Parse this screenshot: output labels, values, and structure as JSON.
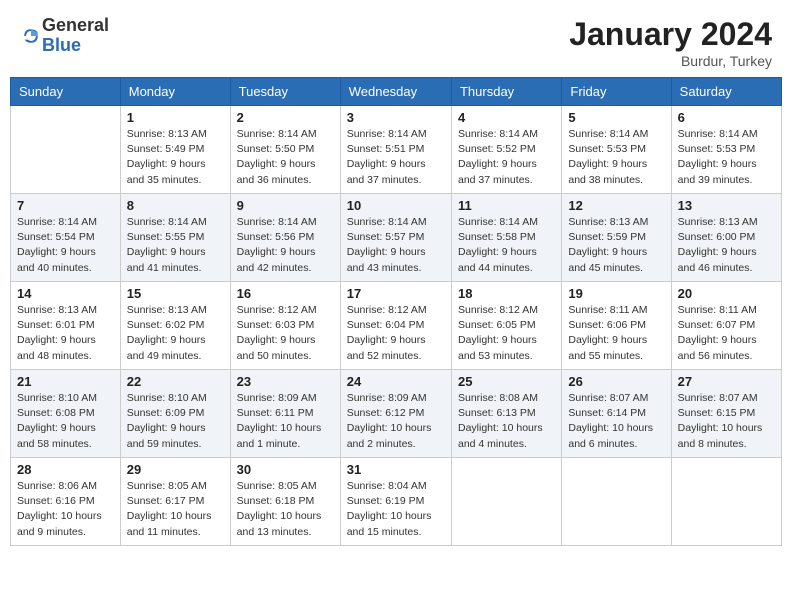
{
  "header": {
    "logo_general": "General",
    "logo_blue": "Blue",
    "month_title": "January 2024",
    "location": "Burdur, Turkey"
  },
  "days_of_week": [
    "Sunday",
    "Monday",
    "Tuesday",
    "Wednesday",
    "Thursday",
    "Friday",
    "Saturday"
  ],
  "weeks": [
    [
      {
        "day": "",
        "info": ""
      },
      {
        "day": "1",
        "info": "Sunrise: 8:13 AM\nSunset: 5:49 PM\nDaylight: 9 hours\nand 35 minutes."
      },
      {
        "day": "2",
        "info": "Sunrise: 8:14 AM\nSunset: 5:50 PM\nDaylight: 9 hours\nand 36 minutes."
      },
      {
        "day": "3",
        "info": "Sunrise: 8:14 AM\nSunset: 5:51 PM\nDaylight: 9 hours\nand 37 minutes."
      },
      {
        "day": "4",
        "info": "Sunrise: 8:14 AM\nSunset: 5:52 PM\nDaylight: 9 hours\nand 37 minutes."
      },
      {
        "day": "5",
        "info": "Sunrise: 8:14 AM\nSunset: 5:53 PM\nDaylight: 9 hours\nand 38 minutes."
      },
      {
        "day": "6",
        "info": "Sunrise: 8:14 AM\nSunset: 5:53 PM\nDaylight: 9 hours\nand 39 minutes."
      }
    ],
    [
      {
        "day": "7",
        "info": "Sunrise: 8:14 AM\nSunset: 5:54 PM\nDaylight: 9 hours\nand 40 minutes."
      },
      {
        "day": "8",
        "info": "Sunrise: 8:14 AM\nSunset: 5:55 PM\nDaylight: 9 hours\nand 41 minutes."
      },
      {
        "day": "9",
        "info": "Sunrise: 8:14 AM\nSunset: 5:56 PM\nDaylight: 9 hours\nand 42 minutes."
      },
      {
        "day": "10",
        "info": "Sunrise: 8:14 AM\nSunset: 5:57 PM\nDaylight: 9 hours\nand 43 minutes."
      },
      {
        "day": "11",
        "info": "Sunrise: 8:14 AM\nSunset: 5:58 PM\nDaylight: 9 hours\nand 44 minutes."
      },
      {
        "day": "12",
        "info": "Sunrise: 8:13 AM\nSunset: 5:59 PM\nDaylight: 9 hours\nand 45 minutes."
      },
      {
        "day": "13",
        "info": "Sunrise: 8:13 AM\nSunset: 6:00 PM\nDaylight: 9 hours\nand 46 minutes."
      }
    ],
    [
      {
        "day": "14",
        "info": "Sunrise: 8:13 AM\nSunset: 6:01 PM\nDaylight: 9 hours\nand 48 minutes."
      },
      {
        "day": "15",
        "info": "Sunrise: 8:13 AM\nSunset: 6:02 PM\nDaylight: 9 hours\nand 49 minutes."
      },
      {
        "day": "16",
        "info": "Sunrise: 8:12 AM\nSunset: 6:03 PM\nDaylight: 9 hours\nand 50 minutes."
      },
      {
        "day": "17",
        "info": "Sunrise: 8:12 AM\nSunset: 6:04 PM\nDaylight: 9 hours\nand 52 minutes."
      },
      {
        "day": "18",
        "info": "Sunrise: 8:12 AM\nSunset: 6:05 PM\nDaylight: 9 hours\nand 53 minutes."
      },
      {
        "day": "19",
        "info": "Sunrise: 8:11 AM\nSunset: 6:06 PM\nDaylight: 9 hours\nand 55 minutes."
      },
      {
        "day": "20",
        "info": "Sunrise: 8:11 AM\nSunset: 6:07 PM\nDaylight: 9 hours\nand 56 minutes."
      }
    ],
    [
      {
        "day": "21",
        "info": "Sunrise: 8:10 AM\nSunset: 6:08 PM\nDaylight: 9 hours\nand 58 minutes."
      },
      {
        "day": "22",
        "info": "Sunrise: 8:10 AM\nSunset: 6:09 PM\nDaylight: 9 hours\nand 59 minutes."
      },
      {
        "day": "23",
        "info": "Sunrise: 8:09 AM\nSunset: 6:11 PM\nDaylight: 10 hours\nand 1 minute."
      },
      {
        "day": "24",
        "info": "Sunrise: 8:09 AM\nSunset: 6:12 PM\nDaylight: 10 hours\nand 2 minutes."
      },
      {
        "day": "25",
        "info": "Sunrise: 8:08 AM\nSunset: 6:13 PM\nDaylight: 10 hours\nand 4 minutes."
      },
      {
        "day": "26",
        "info": "Sunrise: 8:07 AM\nSunset: 6:14 PM\nDaylight: 10 hours\nand 6 minutes."
      },
      {
        "day": "27",
        "info": "Sunrise: 8:07 AM\nSunset: 6:15 PM\nDaylight: 10 hours\nand 8 minutes."
      }
    ],
    [
      {
        "day": "28",
        "info": "Sunrise: 8:06 AM\nSunset: 6:16 PM\nDaylight: 10 hours\nand 9 minutes."
      },
      {
        "day": "29",
        "info": "Sunrise: 8:05 AM\nSunset: 6:17 PM\nDaylight: 10 hours\nand 11 minutes."
      },
      {
        "day": "30",
        "info": "Sunrise: 8:05 AM\nSunset: 6:18 PM\nDaylight: 10 hours\nand 13 minutes."
      },
      {
        "day": "31",
        "info": "Sunrise: 8:04 AM\nSunset: 6:19 PM\nDaylight: 10 hours\nand 15 minutes."
      },
      {
        "day": "",
        "info": ""
      },
      {
        "day": "",
        "info": ""
      },
      {
        "day": "",
        "info": ""
      }
    ]
  ]
}
